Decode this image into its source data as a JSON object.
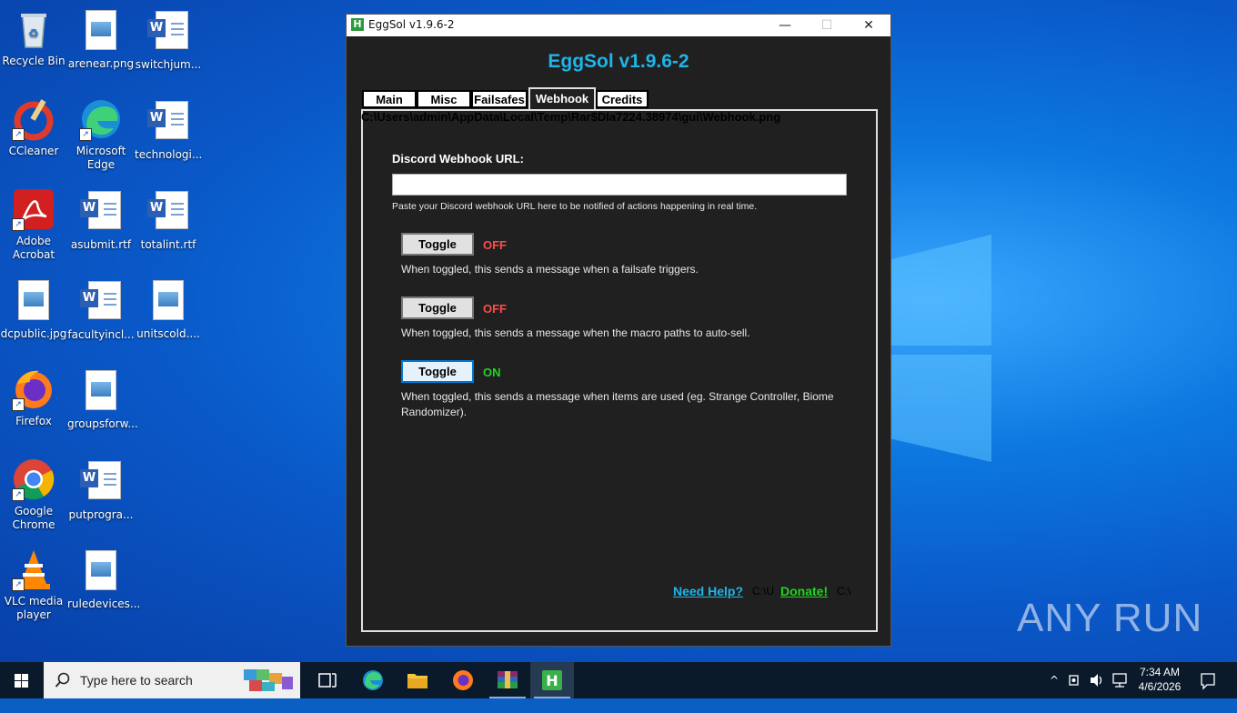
{
  "desktop": {
    "icons": [
      {
        "label": "Recycle Bin",
        "icon": "recycle-bin-icon"
      },
      {
        "label": "arenear.png",
        "icon": "image-file-icon"
      },
      {
        "label": "switchjum...",
        "icon": "word-doc-icon"
      },
      {
        "label": "CCleaner",
        "icon": "ccleaner-icon"
      },
      {
        "label": "Microsoft Edge",
        "icon": "edge-icon"
      },
      {
        "label": "technologi...",
        "icon": "word-doc-icon"
      },
      {
        "label": "Adobe Acrobat",
        "icon": "acrobat-icon"
      },
      {
        "label": "asubmit.rtf",
        "icon": "word-doc-icon"
      },
      {
        "label": "totalint.rtf",
        "icon": "word-doc-icon"
      },
      {
        "label": "dcpublic.jpg",
        "icon": "image-file-icon"
      },
      {
        "label": "facultyincl...",
        "icon": "word-doc-icon"
      },
      {
        "label": "unitscold....",
        "icon": "image-file-icon"
      },
      {
        "label": "Firefox",
        "icon": "firefox-icon"
      },
      {
        "label": "groupsforw...",
        "icon": "image-file-icon"
      },
      {
        "label": "Google Chrome",
        "icon": "chrome-icon"
      },
      {
        "label": "putprogra...",
        "icon": "word-doc-icon"
      },
      {
        "label": "VLC media player",
        "icon": "vlc-icon"
      },
      {
        "label": "ruledevices...",
        "icon": "image-file-icon"
      }
    ],
    "watermark": "ANY RUN"
  },
  "window": {
    "title": "EggSol v1.9.6-2",
    "app_icon_letter": "H",
    "minimize": "—",
    "maximize": "☐",
    "close": "✕",
    "heading": "EggSol v1.9.6-2",
    "tabs": [
      "Main",
      "Misc",
      "Failsafes",
      "Webhook",
      "Credits"
    ],
    "active_tab": "Webhook",
    "path_overlay": "C:\\Users\\admin\\AppData\\Local\\Temp\\Rar$DIa7224.38974\\gui\\Webhook.png",
    "webhook_label": "Discord Webhook URL:",
    "webhook_value": "",
    "webhook_hint": "Paste your Discord webhook URL here to be notified of actions happening in real time.",
    "toggles": [
      {
        "button": "Toggle",
        "state": "OFF",
        "state_color": "#ff4b4b",
        "desc": "When toggled, this sends a message when a failsafe triggers."
      },
      {
        "button": "Toggle",
        "state": "OFF",
        "state_color": "#ff4b4b",
        "desc": "When toggled, this sends a message when the macro paths to auto-sell."
      },
      {
        "button": "Toggle",
        "state": "ON",
        "state_color": "#22d422",
        "desc": "When toggled, this sends a message when items are used (eg. Strange Controller, Biome Randomizer)."
      }
    ],
    "need_help": "Need Help?",
    "path_small_1": "C:\\U",
    "donate": "Donate!",
    "path_small_2": "C:\\"
  },
  "taskbar": {
    "search_placeholder": "Type here to search",
    "apps": [
      "task-view-icon",
      "edge-icon",
      "file-explorer-icon",
      "firefox-icon",
      "winrar-icon",
      "eggsol-icon"
    ],
    "time": "7:34 AM",
    "date": "4/6/2026"
  }
}
